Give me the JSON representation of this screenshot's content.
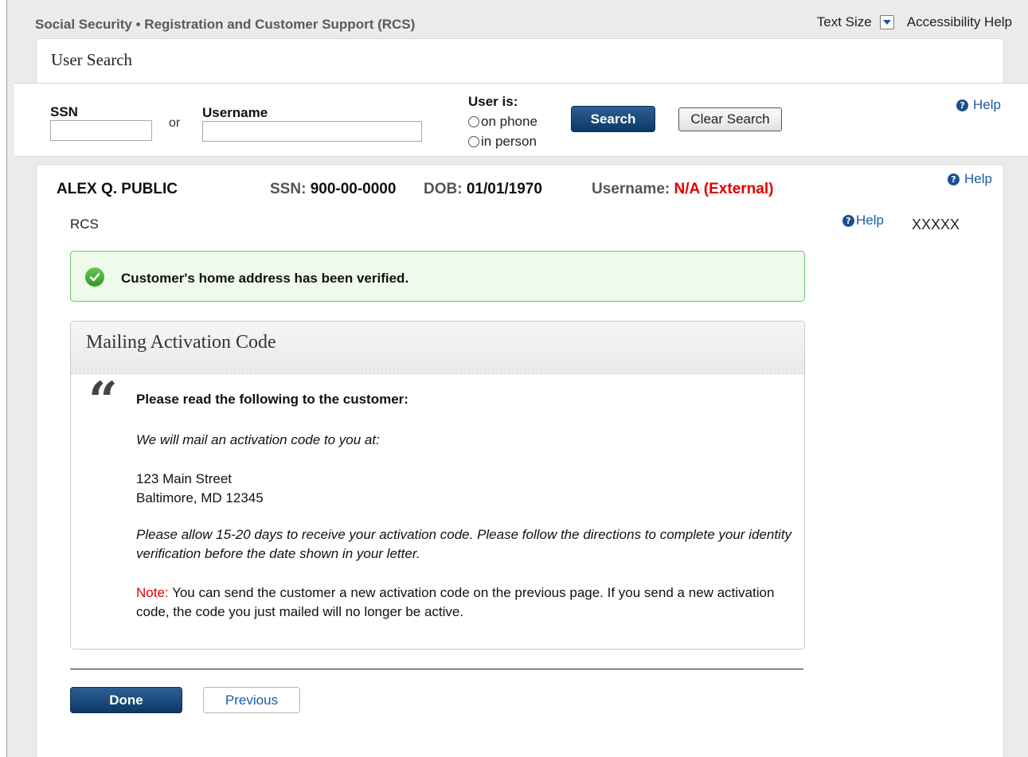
{
  "header": {
    "app_title": "Social Security • Registration and Customer Support (RCS)",
    "text_size_label": "Text Size",
    "accessibility_help": "Accessibility Help"
  },
  "user_search": {
    "title": "User Search",
    "ssn_label": "SSN",
    "ssn_value": "",
    "or_label": "or",
    "username_label": "Username",
    "username_value": "",
    "user_is_label": "User is:",
    "options": [
      "on phone",
      "in person"
    ],
    "search_button": "Search",
    "clear_button": "Clear Search",
    "help": "Help"
  },
  "customer": {
    "name": "ALEX Q. PUBLIC",
    "ssn_label": "SSN:",
    "ssn": "900-00-0000",
    "dob_label": "DOB:",
    "dob": "01/01/1970",
    "username_label": "Username:",
    "username": "N/A (External)",
    "help": "Help",
    "rcs_label": "RCS",
    "rcs_help": "Help",
    "code": "XXXXX"
  },
  "success_message": "Customer's home address has been verified.",
  "mailing_panel": {
    "title": "Mailing Activation Code",
    "read_prompt": "Please read the following to the customer:",
    "line1": "We will mail an activation code to you at:",
    "address_line1": "123 Main Street",
    "address_line2": "Baltimore, MD 12345",
    "allow_text": "Please allow 15-20 days to receive your activation code. Please follow the directions to complete your identity verification before the date shown in your letter.",
    "note_label": "Note:",
    "note_text": "You can send the customer a new activation code on the previous page. If you send a new activation code, the code you just mailed will no longer be active."
  },
  "actions": {
    "done": "Done",
    "previous": "Previous"
  },
  "colors": {
    "primary_button": "#0c3866",
    "success_border": "#6fc26a",
    "alert_red": "#e00000",
    "link_blue": "#1a5aa8"
  }
}
